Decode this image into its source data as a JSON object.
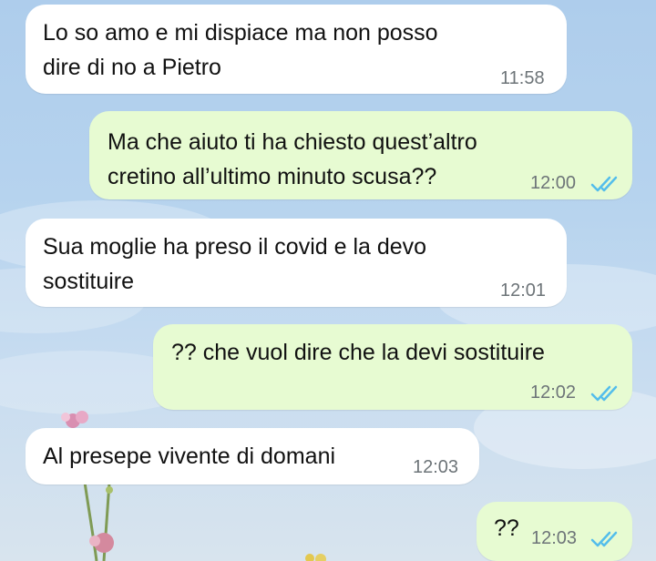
{
  "chat": {
    "messages": [
      {
        "direction": "incoming",
        "text": "Lo so amo e mi dispiace ma non posso\ndire di no a Pietro",
        "time": "11:58"
      },
      {
        "direction": "outgoing",
        "text": "Ma che aiuto ti ha chiesto quest’altro\ncretino all’ultimo minuto scusa??",
        "time": "12:00",
        "status": "read"
      },
      {
        "direction": "incoming",
        "text": "Sua moglie ha preso il covid e la devo\nsostituire",
        "time": "12:01"
      },
      {
        "direction": "outgoing",
        "text": "?? che vuol dire che la devi sostituire",
        "time": "12:02",
        "status": "read"
      },
      {
        "direction": "incoming",
        "text": "Al presepe vivente di domani",
        "time": "12:03"
      },
      {
        "direction": "outgoing",
        "text": "??",
        "time": "12:03",
        "status": "read"
      }
    ],
    "colors": {
      "incoming_bubble": "#ffffff",
      "outgoing_bubble": "#e7fbd2",
      "read_ticks": "#53bdeb",
      "time_text": "#6d7478"
    },
    "read_icon": "double-check-icon"
  }
}
